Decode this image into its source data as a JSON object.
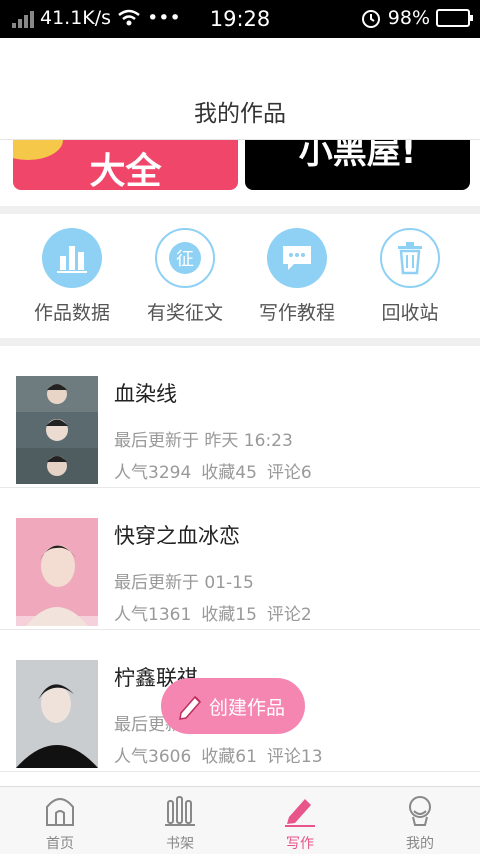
{
  "status_bar": {
    "speed": "41.1K/s",
    "time": "19:28",
    "battery": "98%",
    "battery_level": 0.98
  },
  "header": {
    "title": "我的作品"
  },
  "banners": {
    "left_text": "大全",
    "right_text": "小黑屋!"
  },
  "shortcuts": [
    {
      "label": "作品数据",
      "icon": "bar-chart-icon"
    },
    {
      "label": "有奖征文",
      "icon": "contest-icon"
    },
    {
      "label": "写作教程",
      "icon": "chat-bubble-icon"
    },
    {
      "label": "回收站",
      "icon": "trash-icon"
    }
  ],
  "works": [
    {
      "title": "血染线",
      "updated": "最后更新于 昨天 16:23",
      "popularity": "人气3294",
      "favorites": "收藏45",
      "comments": "评论6"
    },
    {
      "title": "快穿之血冰恋",
      "updated": "最后更新于 01-15",
      "popularity": "人气1361",
      "favorites": "收藏15",
      "comments": "评论2"
    },
    {
      "title": "柠鑫联祺",
      "updated": "最后更新于",
      "popularity": "人气3606",
      "favorites": "收藏61",
      "comments": "评论13"
    }
  ],
  "fab": {
    "label": "创建作品"
  },
  "tabbar": [
    {
      "label": "首页",
      "active": false
    },
    {
      "label": "书架",
      "active": false
    },
    {
      "label": "写作",
      "active": true
    },
    {
      "label": "我的",
      "active": false
    }
  ],
  "colors": {
    "accent": "#e8558a",
    "icon_blue": "#8fd1f4",
    "fab": "#f586b2"
  }
}
